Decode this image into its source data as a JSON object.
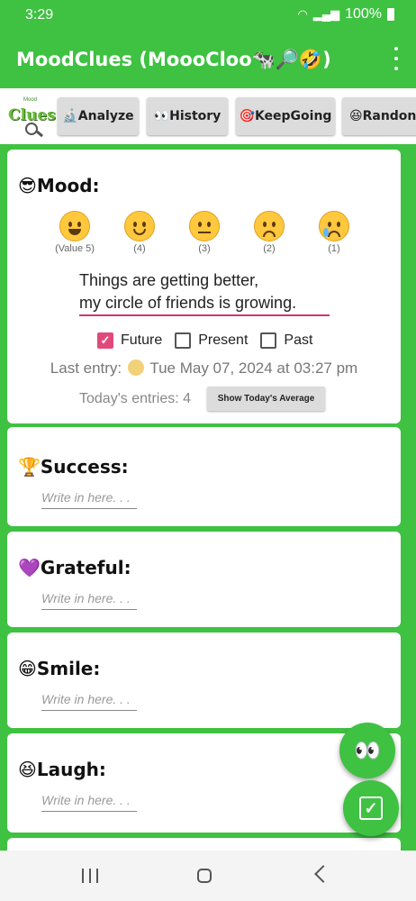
{
  "status_bar": {
    "time": "3:29",
    "battery": "100%"
  },
  "app_bar": {
    "title": "MoodClues (MoooCloo🐄🔎🤣)"
  },
  "toolbar": {
    "logo_top": "Mood",
    "logo_main": "Clues",
    "buttons": [
      {
        "label": "🔬Analyze"
      },
      {
        "label": "👀History"
      },
      {
        "label": "🎯KeepGoing"
      },
      {
        "label": "😆Randon"
      }
    ]
  },
  "mood": {
    "title": "😎Mood:",
    "faces": [
      {
        "value_label": "(Value 5)"
      },
      {
        "value_label": "(4)"
      },
      {
        "value_label": "(3)"
      },
      {
        "value_label": "(2)"
      },
      {
        "value_label": "(1)"
      }
    ],
    "quote_line1": "Things are getting better,",
    "quote_line2": "my circle of friends is growing.",
    "checkboxes": [
      {
        "label": "Future",
        "checked": true
      },
      {
        "label": "Present",
        "checked": false
      },
      {
        "label": "Past",
        "checked": false
      }
    ],
    "last_entry_prefix": "Last entry:",
    "last_entry_text": "Tue May 07, 2024 at 03:27 pm",
    "todays_entries": "Today's entries: 4",
    "average_button": "Show Today's Average"
  },
  "sections": [
    {
      "title": "🏆Success:",
      "placeholder": "Write in here. . ."
    },
    {
      "title": "💜Grateful:",
      "placeholder": "Write in here. . ."
    },
    {
      "title": "😁Smile:",
      "placeholder": "Write in here. . ."
    },
    {
      "title": "😆Laugh:",
      "placeholder": "Write in here. . ."
    }
  ],
  "fabs": {
    "eyes_icon": "👀",
    "check_icon": "☑"
  },
  "colors": {
    "primary_green": "#3fc142",
    "checkbox_pink": "#e2497b",
    "underline_pink": "#d6336c"
  }
}
